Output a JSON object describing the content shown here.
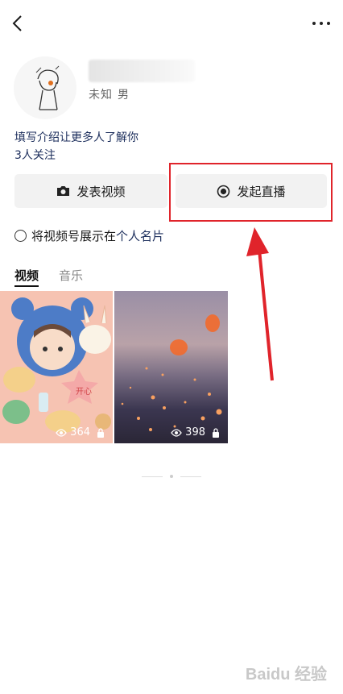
{
  "profile": {
    "meta_unknown": "未知",
    "meta_gender": "男",
    "intro": "填写介绍让更多人了解你",
    "follow": "3人关注"
  },
  "actions": {
    "post_video": "发表视频",
    "go_live": "发起直播"
  },
  "show_card": {
    "prefix": "将视频号展示在",
    "link": "个人名片"
  },
  "tabs": [
    {
      "label": "视频"
    },
    {
      "label": "音乐"
    }
  ],
  "videos": [
    {
      "views": "364",
      "cover_text": "开心"
    },
    {
      "views": "398"
    }
  ],
  "icons": [
    "back-icon",
    "more-icon",
    "camera-icon",
    "live-icon",
    "eye-icon",
    "lock-icon"
  ],
  "colors": {
    "accent_link": "#1c2e5c",
    "highlight": "#e0242b"
  }
}
